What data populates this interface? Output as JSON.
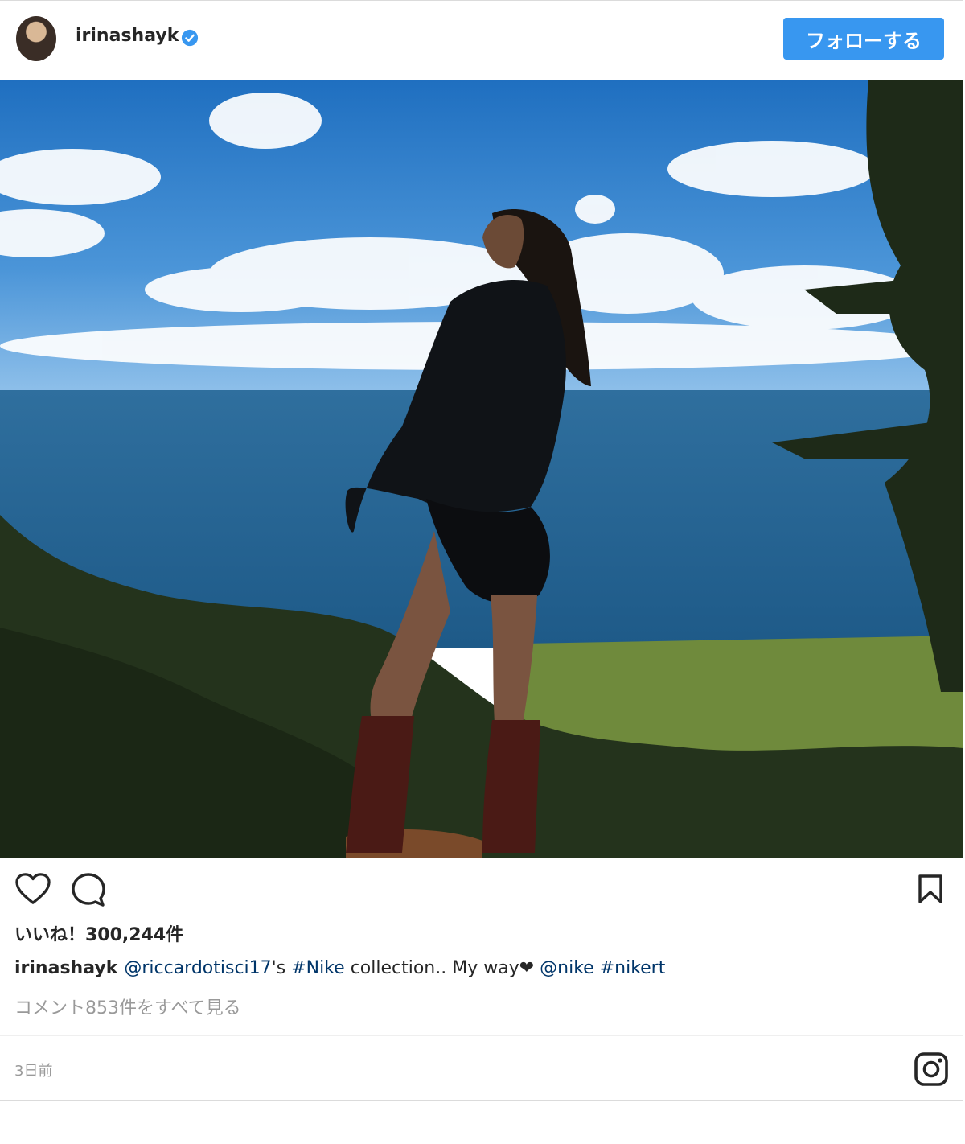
{
  "post": {
    "username": "irinashayk",
    "follow_label": "フォローする",
    "likes_text": "いいね！300,244件",
    "caption": {
      "username": "irinashayk",
      "mention_1": "@riccardotisci17",
      "text_1": "'s",
      "hashtag_1": "#Nike",
      "text_2": "collection.. My way",
      "heart": "❤",
      "mention_2": "@nike",
      "hashtag_2": "#nikert"
    },
    "view_comments": "コメント853件をすべて見る",
    "time_ago": "3日前"
  },
  "icons": {
    "verified": "verified-badge-icon",
    "like": "heart-outline-icon",
    "comment": "comment-bubble-icon",
    "save": "bookmark-icon",
    "instagram": "instagram-logo-icon"
  },
  "colors": {
    "follow_button": "#3897f0",
    "link": "#003569",
    "muted": "#999999",
    "verified": "#3897f0"
  }
}
